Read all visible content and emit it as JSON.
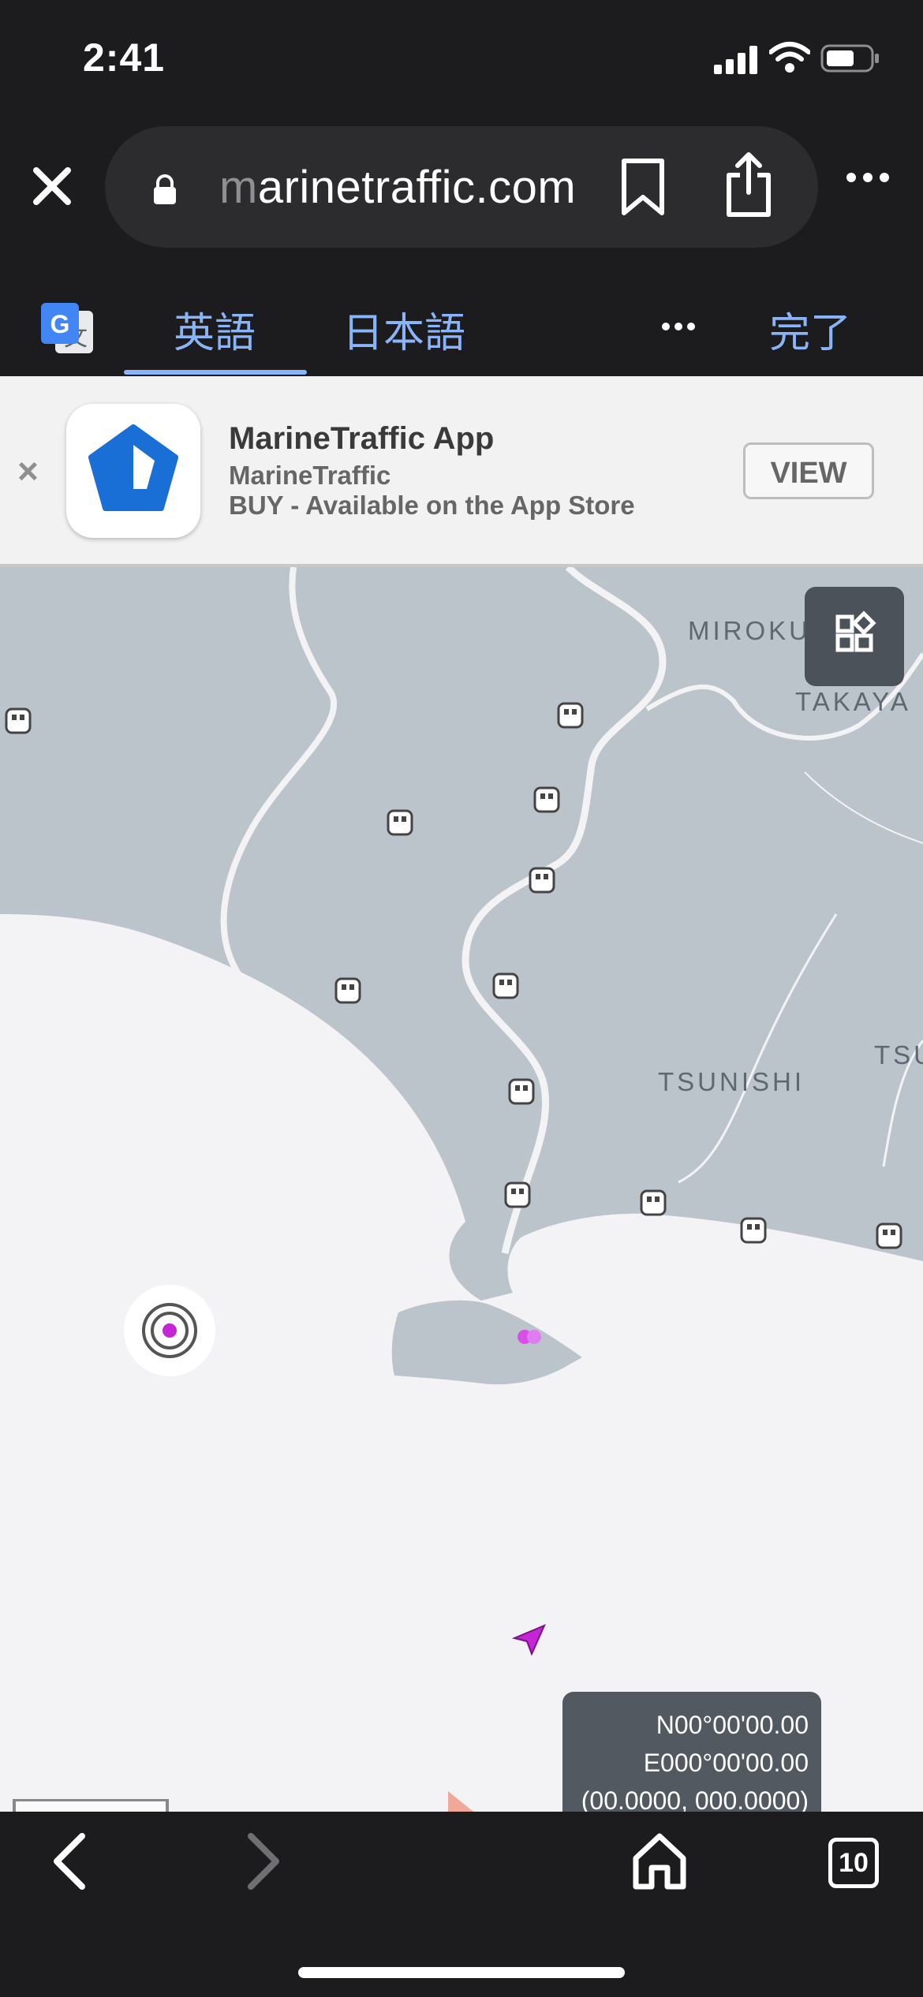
{
  "status_bar": {
    "time": "2:41"
  },
  "browser": {
    "url_faded": "m",
    "url_main": "arinetraffic.com"
  },
  "translate_bar": {
    "source_lang": "英語",
    "target_lang": "日本語",
    "done_label": "完了"
  },
  "app_banner": {
    "close_label": "×",
    "app_name": "MarineTraffic App",
    "developer": "MarineTraffic",
    "availability": "BUY - Available on the App Store",
    "view_label": "VIEW",
    "brand_color": "#1a6fd6"
  },
  "map": {
    "places": {
      "miroku": "MIROKU",
      "takaya": "TAKAYA",
      "tsunishi": "TSUNISHI",
      "tsu": "TSU"
    },
    "coordinates": {
      "lat": "N00°00'00.00",
      "lon": "E000°00'00.00",
      "decimal": "(00.0000, 000.0000)"
    },
    "colors": {
      "land": "#bcc4cb",
      "sea": "#f3f3f5",
      "vessel": "#c426d6"
    }
  },
  "toolbar": {
    "tab_count": "10"
  }
}
